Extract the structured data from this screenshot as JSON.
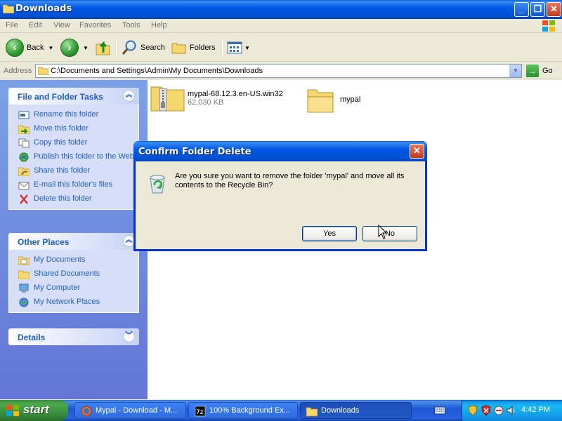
{
  "window": {
    "title": "Downloads"
  },
  "menu": [
    "File",
    "Edit",
    "View",
    "Favorites",
    "Tools",
    "Help"
  ],
  "toolbar": {
    "back": "Back",
    "search": "Search",
    "folders": "Folders"
  },
  "address": {
    "label": "Address",
    "value": "C:\\Documents and Settings\\Admin\\My Documents\\Downloads",
    "go": "Go"
  },
  "sidebar": {
    "file_tasks": {
      "title": "File and Folder Tasks",
      "items": [
        {
          "label": "Rename this folder",
          "icon": "rename-icon"
        },
        {
          "label": "Move this folder",
          "icon": "move-icon"
        },
        {
          "label": "Copy this folder",
          "icon": "copy-icon"
        },
        {
          "label": "Publish this folder to the Web",
          "icon": "web-icon"
        },
        {
          "label": "Share this folder",
          "icon": "share-icon"
        },
        {
          "label": "E-mail this folder's files",
          "icon": "email-icon"
        },
        {
          "label": "Delete this folder",
          "icon": "delete-icon"
        }
      ]
    },
    "other_places": {
      "title": "Other Places",
      "items": [
        {
          "label": "My Documents",
          "icon": "my-documents-icon"
        },
        {
          "label": "Shared Documents",
          "icon": "folder-icon"
        },
        {
          "label": "My Computer",
          "icon": "computer-icon"
        },
        {
          "label": "My Network Places",
          "icon": "network-icon"
        }
      ]
    },
    "details": {
      "title": "Details"
    }
  },
  "files": [
    {
      "name": "mypal-68.12.3.en-US.win32",
      "size": "62,030 KB",
      "icon": "zip-folder-icon"
    },
    {
      "name": "mypal",
      "size": "",
      "icon": "folder-icon"
    }
  ],
  "dialog": {
    "title": "Confirm Folder Delete",
    "message": "Are you sure you want to remove the folder 'mypal' and move all its contents to the Recycle Bin?",
    "yes": "Yes",
    "no": "No"
  },
  "taskbar": {
    "start": "start",
    "tasks": [
      {
        "label": "Mypal - Download - M...",
        "icon": "mypal-icon"
      },
      {
        "label": "100% Background Ex...",
        "icon": "7zip-icon"
      },
      {
        "label": "Downloads",
        "icon": "folder-icon"
      }
    ],
    "clock": "4:42 PM"
  },
  "colors": {
    "titlebar": "#0058E6",
    "taskpane": "#6375D6",
    "link": "#215DC6",
    "start": "#3C8F3C"
  }
}
